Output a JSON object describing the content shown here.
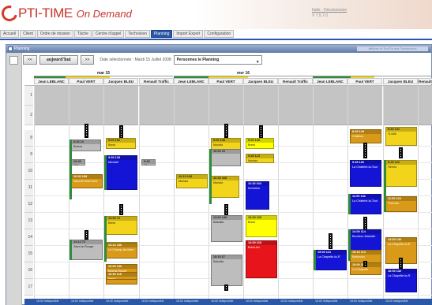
{
  "app": {
    "name": "PTI-TIME",
    "subtitle": "On Demand"
  },
  "header": {
    "user_link": "Italie - Déconnexion",
    "version": "V 7.5.7.0"
  },
  "tabs": [
    {
      "label": "Accueil",
      "active": false
    },
    {
      "label": "Client",
      "active": false
    },
    {
      "label": "Ordre de mission",
      "active": false
    },
    {
      "label": "Tâche",
      "active": false
    },
    {
      "label": "Centre d'appel",
      "active": false
    },
    {
      "label": "Technicien",
      "active": false
    },
    {
      "label": "Planning",
      "active": true
    },
    {
      "label": "Import Export",
      "active": false
    },
    {
      "label": "Configuration",
      "active": false
    }
  ],
  "panel": {
    "title": "Planning",
    "title_right": "Afficher le ToolTip des Techniciens"
  },
  "nav": {
    "prev": "<<",
    "today": "aujourd'hui",
    "next": ">>",
    "selected_date": "Date sélectionnée : Mardi 15 Juillet 2008",
    "select_value": "Personnes le Planning"
  },
  "days": [
    {
      "label": "mar 15"
    },
    {
      "label": "mer 16"
    }
  ],
  "resources": [
    "Jean LEBLANC",
    "Paul VERT",
    "Jacques BLEU",
    "Renault Traffic",
    "Jean LEBLANC",
    "Paul VERT",
    "Jacques BLEU",
    "Renault Traffic",
    "Jean LEBLANC",
    "Paul VERT",
    "Jacques BLEU",
    "Renault T"
  ],
  "hours": [
    "8",
    "9",
    "10",
    "11",
    "12",
    "13",
    "14",
    "15",
    "16",
    "17"
  ],
  "hour_pre": [
    "1",
    "2"
  ],
  "footer_label": "16:00 Indisponible",
  "tasks": [
    {
      "top": "8:30 10",
      "label": "Bolera",
      "color": "#bdbdbd"
    },
    {
      "top": "9:00 162",
      "label": "Brest",
      "color": "#f2d41a"
    },
    {
      "top": "9:00 148",
      "label": "Morlaix",
      "color": "#f2d41a"
    },
    {
      "top": "9:00 128",
      "label": "Brest",
      "color": "#ffff00"
    },
    {
      "top": "9:45 123",
      "label": "Morlaix",
      "color": "#f2d41a"
    },
    {
      "top": "8:45 128",
      "label": "Château",
      "color": "#d89a18"
    },
    {
      "top": "8:30 131",
      "label": "Ti-ville",
      "color": "#f2d41a"
    },
    {
      "top": "9:30 128",
      "label": "Michaël",
      "color": "#1414d6"
    },
    {
      "top": "9:45 18",
      "label": "",
      "color": "#bdbdbd"
    },
    {
      "top": "10:30 174",
      "label": "Brest",
      "color": "#bdbdbd"
    },
    {
      "top": "10:00 16",
      "label": "",
      "color": "#bdbdbd"
    },
    {
      "top": "10:30 108",
      "label": "Saint-Ernest-Nord",
      "color": "#d89a18"
    },
    {
      "top": "11:15 104",
      "label": "Kerstrew",
      "color": "#1414d6"
    },
    {
      "top": "10:30 168",
      "label": "Morlaix",
      "color": "#f2d41a"
    },
    {
      "top": "10:15 128",
      "label": "Morlaix",
      "color": "#f2d41a"
    },
    {
      "top": "9:45 132",
      "label": "La Châtelet-la-Tour",
      "color": "#1414d6"
    },
    {
      "top": "9:45 122",
      "label": "Henrio",
      "color": "#f2d41a"
    },
    {
      "top": "11:00 132",
      "label": "La Châtelet-la-Tour",
      "color": "#1414d6"
    },
    {
      "top": "11:30 123",
      "label": "Thomas",
      "color": "#d89a18"
    },
    {
      "top": "13:00 72",
      "label": "Brest",
      "color": "#f2d41a"
    },
    {
      "top": "13:00 248",
      "label": "Balcalla",
      "color": "#bdbdbd"
    },
    {
      "top": "13:00 125",
      "label": "Brest",
      "color": "#ffff00"
    },
    {
      "top": "13:45 118",
      "label": "Brest",
      "color": "#f2d41a"
    },
    {
      "top": "14:12 72",
      "label": "Saint-le-Rouge",
      "color": "#bdbdbd"
    },
    {
      "top": "14:12 136",
      "label": "Le Champ-de-Mars",
      "color": "#d89a18"
    },
    {
      "top": "14:00 218",
      "label": "Brest-lez",
      "color": "#e8141b"
    },
    {
      "top": "14:00 114",
      "label": "Bourbon-Marlotte",
      "color": "#1414d6"
    },
    {
      "top": "14:30 146",
      "label": "La Chapelle-la-R",
      "color": "#d89a18"
    },
    {
      "top": "15:00 121",
      "label": "La Chapelle-la-R",
      "color": "#1414d6"
    },
    {
      "top": "15:15 113",
      "label": "Balvindor",
      "color": "#d89a18"
    },
    {
      "top": "15:15 67",
      "label": "Balcalla",
      "color": "#bdbdbd"
    },
    {
      "top": "15:00 116",
      "label": "La Chapelle",
      "color": "#d89a18"
    },
    {
      "top": "16:00 136",
      "label": "Bolera-Rouge",
      "color": "#d89a18"
    },
    {
      "top": "16:00 132",
      "label": "La Chapelle-la-R",
      "color": "#1414d6"
    },
    {
      "top": "16:30 118",
      "label": "Brest",
      "color": "#d89a18"
    }
  ],
  "colors": {
    "brand": "#c8322a",
    "tab_active": "#2a58a6",
    "footer": "#2a58a6"
  }
}
